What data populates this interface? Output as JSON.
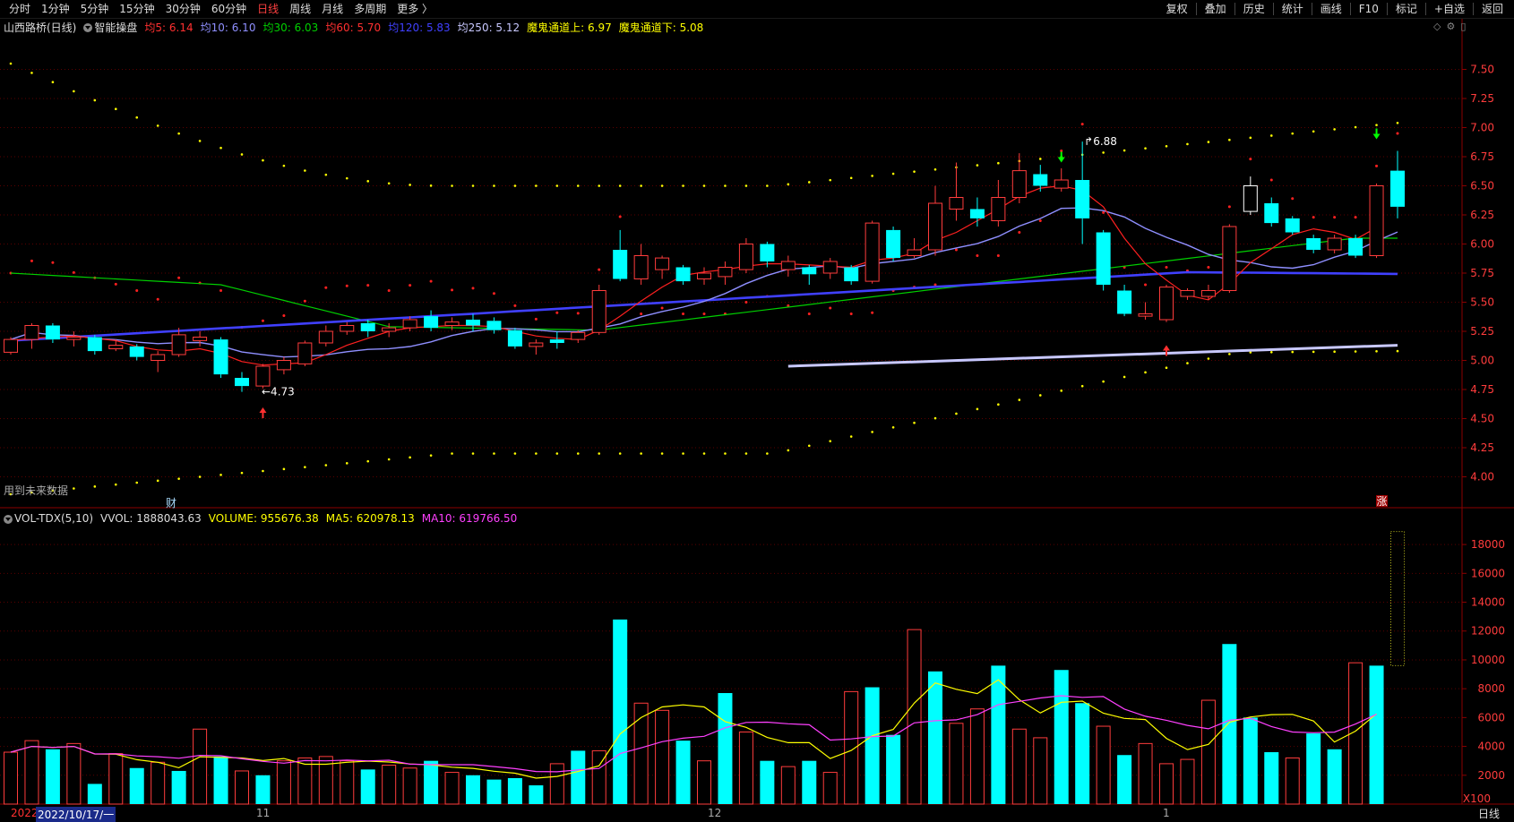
{
  "toolbar": {
    "periods": [
      "分时",
      "1分钟",
      "5分钟",
      "15分钟",
      "30分钟",
      "60分钟",
      "日线",
      "周线",
      "月线",
      "多周期",
      "更多 〉"
    ],
    "active_period": "日线",
    "right_tools": [
      "复权",
      "叠加",
      "历史",
      "统计",
      "画线",
      "F10",
      "标记",
      "+自选",
      "返回"
    ]
  },
  "info": {
    "stock": "山西路桥(日线)",
    "smart": "智能操盘",
    "ma5": "均5: 6.14",
    "ma10": "均10: 6.10",
    "ma30": "均30: 6.03",
    "ma60": "均60: 5.70",
    "ma120": "均120: 5.83",
    "ma250": "均250: 5.12",
    "channel_up": "魔鬼通道上: 6.97",
    "channel_down": "魔鬼通道下: 5.08"
  },
  "colors": {
    "up": "#ff3c3c",
    "down": "#00ffff",
    "ma5": "#ff2020",
    "ma10": "#8f8fff",
    "ma30": "#00d000",
    "ma60": "#ff3030",
    "ma120": "#4040ff",
    "ma250": "#c8c8ff",
    "channel": "#ffff00",
    "grid": "#5a0000",
    "axis": "#8b0000"
  },
  "volume": {
    "title": "VOL-TDX(5,10)",
    "vvol": "VVOL: 1888043.63",
    "volume": "VOLUME: 955676.38",
    "ma5": "MA5: 620978.13",
    "ma10": "MA10: 619766.50",
    "unit": "X100"
  },
  "annotations": {
    "low": "4.73",
    "high": "6.88",
    "future_data": "用到未来数据",
    "finance_mark": "财",
    "zhang_mark": "涨"
  },
  "dates": {
    "year": "2022",
    "current": "2022/10/17/一",
    "m11": "11",
    "m12": "12",
    "m1": "1",
    "period_label": "日线"
  },
  "chart_data": {
    "type": "candlestick",
    "price_axis": {
      "min": 3.75,
      "max": 7.75,
      "ticks": [
        "7.50",
        "7.25",
        "7.00",
        "6.75",
        "6.50",
        "6.25",
        "6.00",
        "5.75",
        "5.50",
        "5.25",
        "5.00",
        "4.75",
        "4.50",
        "4.25",
        "4.00"
      ]
    },
    "volume_axis": {
      "max": 19000,
      "ticks": [
        "18000",
        "16000",
        "14000",
        "12000",
        "10000",
        "8000",
        "6000",
        "4000",
        "2000"
      ]
    },
    "candles": [
      [
        5.07,
        5.18,
        5.2,
        5.05,
        "r"
      ],
      [
        5.18,
        5.3,
        5.32,
        5.1,
        "r"
      ],
      [
        5.3,
        5.18,
        5.32,
        5.15,
        "c"
      ],
      [
        5.18,
        5.2,
        5.25,
        5.12,
        "r"
      ],
      [
        5.2,
        5.08,
        5.22,
        5.05,
        "c"
      ],
      [
        5.1,
        5.13,
        5.18,
        5.08,
        "r"
      ],
      [
        5.12,
        5.03,
        5.14,
        5.0,
        "c"
      ],
      [
        5.0,
        5.05,
        5.08,
        4.9,
        "r"
      ],
      [
        5.05,
        5.22,
        5.28,
        5.03,
        "r"
      ],
      [
        5.2,
        5.17,
        5.25,
        5.12,
        "r"
      ],
      [
        5.18,
        4.88,
        5.2,
        4.85,
        "c"
      ],
      [
        4.85,
        4.78,
        4.9,
        4.73,
        "c"
      ],
      [
        4.78,
        4.95,
        4.97,
        4.76,
        "r"
      ],
      [
        4.92,
        5.0,
        5.03,
        4.88,
        "r"
      ],
      [
        4.97,
        5.15,
        5.17,
        4.95,
        "r"
      ],
      [
        5.15,
        5.25,
        5.3,
        5.12,
        "r"
      ],
      [
        5.25,
        5.3,
        5.33,
        5.22,
        "r"
      ],
      [
        5.32,
        5.25,
        5.35,
        5.2,
        "c"
      ],
      [
        5.25,
        5.28,
        5.32,
        5.2,
        "r"
      ],
      [
        5.28,
        5.35,
        5.38,
        5.25,
        "r"
      ],
      [
        5.38,
        5.28,
        5.43,
        5.25,
        "c"
      ],
      [
        5.3,
        5.33,
        5.37,
        5.26,
        "r"
      ],
      [
        5.35,
        5.3,
        5.4,
        5.25,
        "c"
      ],
      [
        5.34,
        5.26,
        5.37,
        5.23,
        "c"
      ],
      [
        5.26,
        5.12,
        5.28,
        5.1,
        "c"
      ],
      [
        5.12,
        5.15,
        5.18,
        5.05,
        "r"
      ],
      [
        5.18,
        5.15,
        5.25,
        5.1,
        "c"
      ],
      [
        5.18,
        5.24,
        5.26,
        5.15,
        "r"
      ],
      [
        5.24,
        5.6,
        5.65,
        5.22,
        "r"
      ],
      [
        5.95,
        5.7,
        6.12,
        5.68,
        "c"
      ],
      [
        5.7,
        5.9,
        6.0,
        5.65,
        "r"
      ],
      [
        5.88,
        5.78,
        5.9,
        5.7,
        "r"
      ],
      [
        5.8,
        5.68,
        5.82,
        5.65,
        "c"
      ],
      [
        5.7,
        5.75,
        5.8,
        5.65,
        "r"
      ],
      [
        5.72,
        5.8,
        5.85,
        5.65,
        "r"
      ],
      [
        5.78,
        6.0,
        6.05,
        5.75,
        "r"
      ],
      [
        6.0,
        5.85,
        6.02,
        5.8,
        "c"
      ],
      [
        5.85,
        5.78,
        5.9,
        5.72,
        "r"
      ],
      [
        5.8,
        5.74,
        5.82,
        5.65,
        "c"
      ],
      [
        5.75,
        5.85,
        5.88,
        5.7,
        "r"
      ],
      [
        5.8,
        5.68,
        5.82,
        5.65,
        "c"
      ],
      [
        5.68,
        6.18,
        6.2,
        5.66,
        "r"
      ],
      [
        6.12,
        5.88,
        6.15,
        5.85,
        "c"
      ],
      [
        5.9,
        5.95,
        6.05,
        5.88,
        "r"
      ],
      [
        5.95,
        6.35,
        6.5,
        5.9,
        "r"
      ],
      [
        6.3,
        6.4,
        6.7,
        6.2,
        "r"
      ],
      [
        6.3,
        6.22,
        6.4,
        6.15,
        "c"
      ],
      [
        6.2,
        6.4,
        6.55,
        6.15,
        "r"
      ],
      [
        6.4,
        6.63,
        6.78,
        6.35,
        "r"
      ],
      [
        6.6,
        6.5,
        6.68,
        6.45,
        "c"
      ],
      [
        6.48,
        6.55,
        6.65,
        6.45,
        "r"
      ],
      [
        6.55,
        6.22,
        6.88,
        6.0,
        "c"
      ],
      [
        6.1,
        5.65,
        6.12,
        5.6,
        "c"
      ],
      [
        5.6,
        5.4,
        5.65,
        5.38,
        "c"
      ],
      [
        5.4,
        5.38,
        5.5,
        5.35,
        "r"
      ],
      [
        5.35,
        5.63,
        5.65,
        5.33,
        "r"
      ],
      [
        5.6,
        5.55,
        5.62,
        5.52,
        "r"
      ],
      [
        5.55,
        5.6,
        5.65,
        5.52,
        "r"
      ],
      [
        5.6,
        6.15,
        6.17,
        5.58,
        "r"
      ],
      [
        6.5,
        6.28,
        6.58,
        6.25,
        "w"
      ],
      [
        6.35,
        6.18,
        6.4,
        6.15,
        "c"
      ],
      [
        6.22,
        6.1,
        6.24,
        6.08,
        "c"
      ],
      [
        6.05,
        5.95,
        6.08,
        5.92,
        "c"
      ],
      [
        5.95,
        6.05,
        6.08,
        5.92,
        "r"
      ],
      [
        6.05,
        5.9,
        6.08,
        5.88,
        "c"
      ],
      [
        5.9,
        6.5,
        6.52,
        5.88,
        "r"
      ],
      [
        6.63,
        6.32,
        6.8,
        6.22,
        "c"
      ]
    ],
    "volumes": [
      3600,
      4400,
      3800,
      4200,
      1400,
      3500,
      2500,
      2900,
      2300,
      5200,
      3300,
      2300,
      2000,
      3000,
      3200,
      3300,
      3000,
      2400,
      2700,
      2500,
      3000,
      2200,
      2000,
      1700,
      1800,
      1300,
      2800,
      3700,
      3700,
      12800,
      7000,
      6500,
      4400,
      3000,
      7700,
      5000,
      3000,
      2600,
      3000,
      2200,
      7800,
      8100,
      4800,
      12100,
      9200,
      5600,
      6600,
      9600,
      5200,
      4600,
      9300,
      7000,
      5400,
      3400,
      4200,
      2800,
      3100,
      7200,
      11100,
      6000,
      3600,
      3200,
      4900,
      3800,
      9800,
      9600
    ],
    "vol_colors": "rrcrcrcrcrcrcrrrrcrrcrccccrcrcrrcrcrcrcrrccrcrrcrrccrcrrrrcccrccrc",
    "ma5_line": [
      5.17,
      5.19,
      5.2,
      5.21,
      5.19,
      5.17,
      5.12,
      5.09,
      5.08,
      5.1,
      5.06,
      4.99,
      4.96,
      4.97,
      4.98,
      5.05,
      5.13,
      5.19,
      5.25,
      5.28,
      5.29,
      5.3,
      5.3,
      5.29,
      5.25,
      5.21,
      5.19,
      5.18,
      5.26,
      5.38,
      5.51,
      5.63,
      5.73,
      5.76,
      5.78,
      5.81,
      5.83,
      5.83,
      5.82,
      5.81,
      5.8,
      5.86,
      5.88,
      5.92,
      6.03,
      6.1,
      6.2,
      6.3,
      6.41,
      6.48,
      6.5,
      6.46,
      6.32,
      6.05,
      5.83,
      5.69,
      5.56,
      5.52,
      5.66,
      5.84,
      5.96,
      6.08,
      6.13,
      6.1,
      6.04,
      6.14
    ],
    "channel_up_level": 6.97,
    "channel_down_level": 5.08
  }
}
